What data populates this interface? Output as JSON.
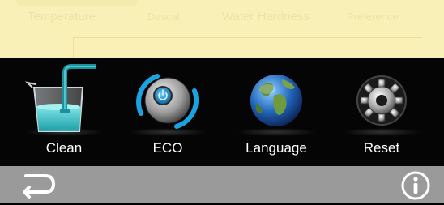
{
  "top_bar": {
    "items": [
      {
        "label": "Temperature"
      },
      {
        "label": "Descal"
      },
      {
        "label": "Water Hardness"
      },
      {
        "label": "Preference"
      }
    ]
  },
  "main_panel": {
    "tiles": [
      {
        "label": "Clean",
        "icon": "beaker-icon"
      },
      {
        "label": "ECO",
        "icon": "eco-power-icon"
      },
      {
        "label": "Language",
        "icon": "globe-icon"
      },
      {
        "label": "Reset",
        "icon": "gear-icon"
      }
    ]
  },
  "bottom_bar": {
    "back_icon": "back-arrow-icon",
    "info_icon": "info-icon"
  },
  "colors": {
    "top_bar_bg": "#f8f0b6",
    "main_bg": "#050505",
    "bottom_bar_bg": "#9a9a9a",
    "eco_accent": "#1aa3e0"
  }
}
